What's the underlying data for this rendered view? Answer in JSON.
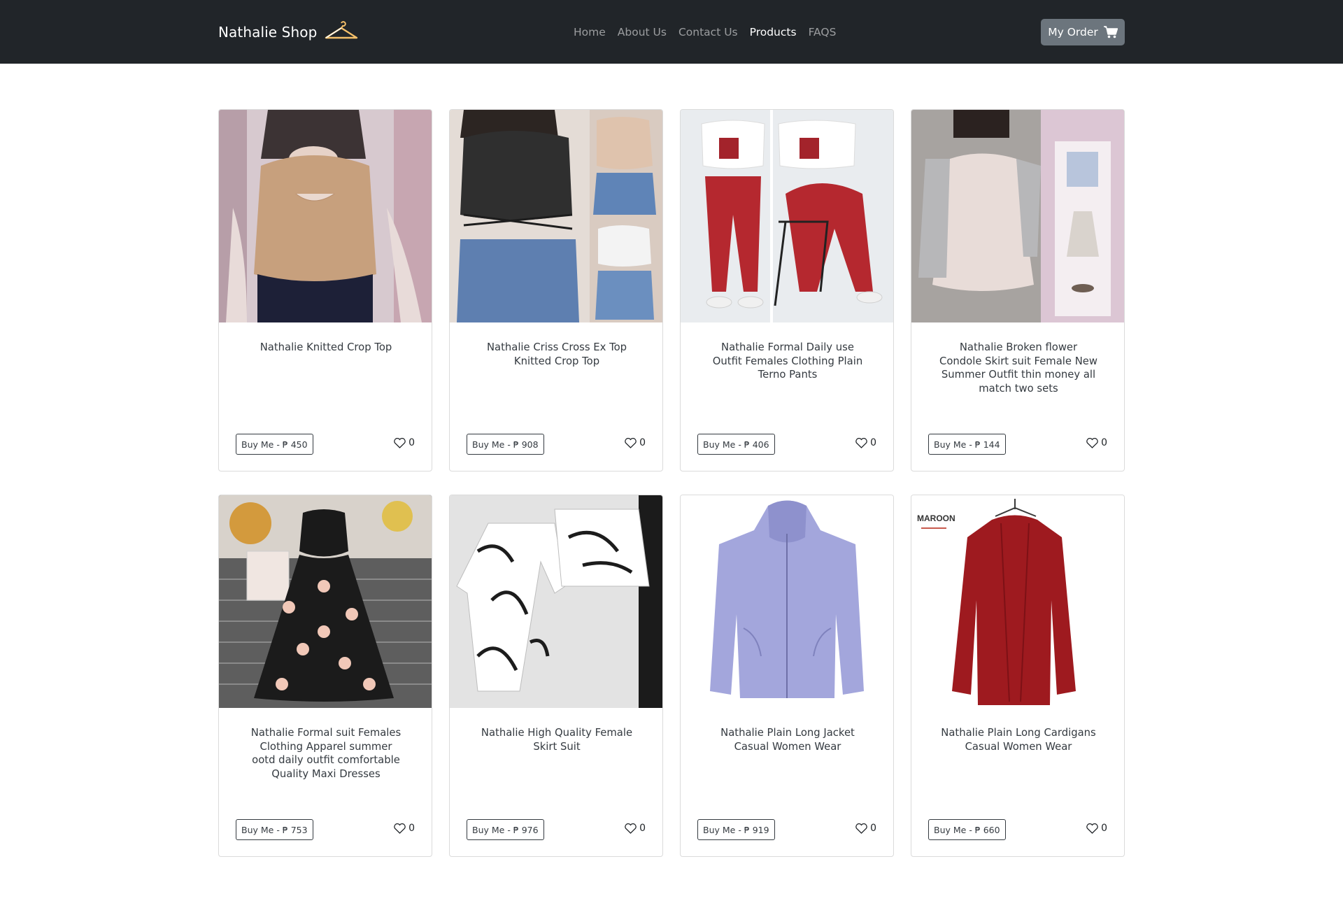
{
  "brand": {
    "name": "Nathalie Shop",
    "icon": "hanger-icon"
  },
  "nav": {
    "links": [
      "Home",
      "About Us",
      "Contact Us",
      "Products",
      "FAQS"
    ],
    "active": "Products"
  },
  "order_button": {
    "label": "My Order",
    "icon": "cart-icon"
  },
  "colors": {
    "navbar": "#212529",
    "order_button": "#6c757d",
    "border": "#343a40"
  },
  "products": [
    {
      "title": "Nathalie Knitted Crop Top",
      "buy_label": "Buy Me - ₱ 450",
      "likes": "0",
      "image": "beige crop top on mannequin"
    },
    {
      "title": "Nathalie Criss Cross Ex Top Knitted Crop Top",
      "buy_label": "Buy Me - ₱ 908",
      "likes": "0",
      "image": "black crop top with denim shorts"
    },
    {
      "title": "Nathalie Formal Daily use Outfit Females Clothing Plain Terno Pants",
      "buy_label": "Buy Me - ₱ 406",
      "likes": "0",
      "image": "white crop top with red jogger pants"
    },
    {
      "title": "Nathalie Broken flower Condole Skirt suit Female New Summer Outfit thin money all match two sets",
      "buy_label": "Buy Me - ₱ 144",
      "likes": "0",
      "image": "floral slip dress with cardigan"
    },
    {
      "title": "Nathalie Formal suit Females Clothing Apparel summer ootd daily outfit comfortable Quality Maxi Dresses",
      "buy_label": "Buy Me - ₱ 753",
      "likes": "0",
      "image": "black floral maxi dress"
    },
    {
      "title": "Nathalie High Quality Female Skirt Suit",
      "buy_label": "Buy Me - ₱ 976",
      "likes": "0",
      "image": "white floral skirt suit"
    },
    {
      "title": "Nathalie Plain Long Jacket Casual Women Wear",
      "buy_label": "Buy Me - ₱ 919",
      "likes": "0",
      "image": "lavender zip hoodie"
    },
    {
      "title": "Nathalie Plain Long Cardigans Casual Women Wear",
      "buy_label": "Buy Me - ₱ 660",
      "likes": "0",
      "image": "maroon long cardigan",
      "image_text": "MAROON"
    }
  ]
}
